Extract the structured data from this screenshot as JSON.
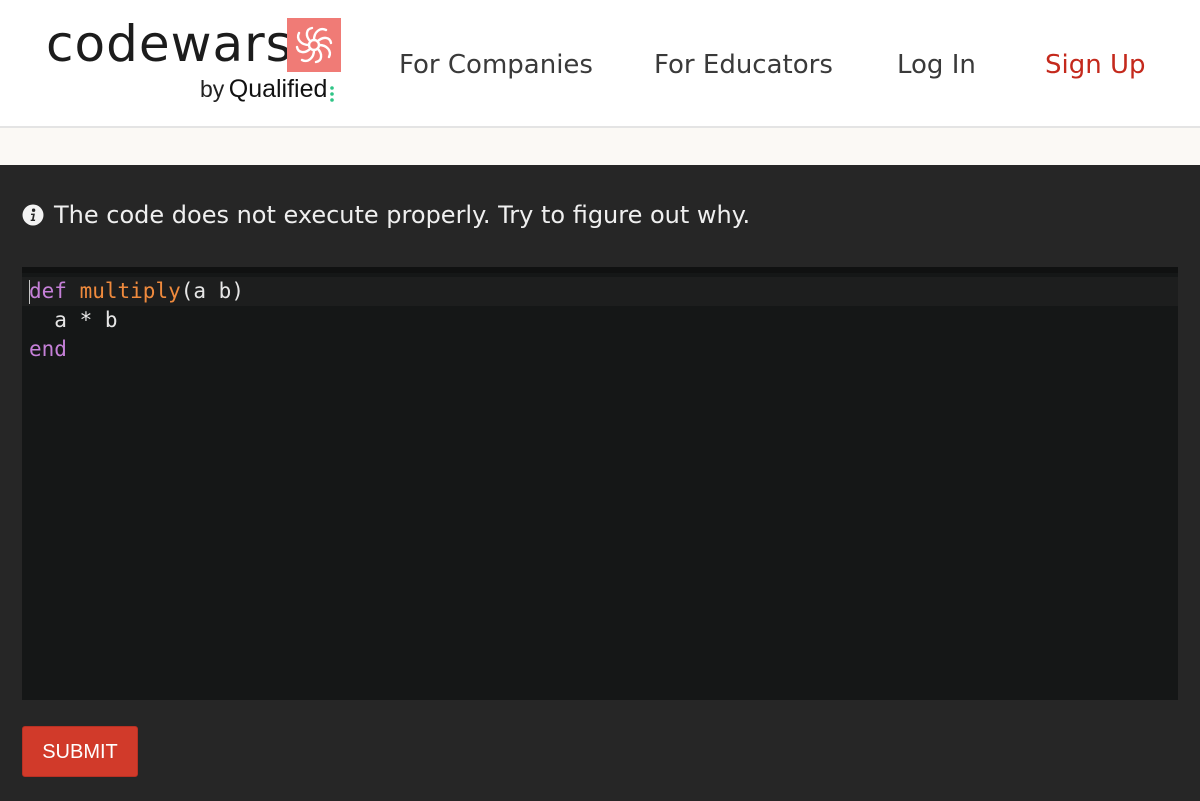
{
  "header": {
    "logo": {
      "wordmark": "codewars",
      "by": "by",
      "brand": "Qualified"
    },
    "nav": [
      {
        "label": "For Companies"
      },
      {
        "label": "For Educators"
      },
      {
        "label": "Log In"
      },
      {
        "label": "Sign Up"
      }
    ]
  },
  "notice": {
    "icon": "info-icon",
    "text": "The code does not execute properly. Try to figure out why."
  },
  "editor": {
    "lines": [
      {
        "tokens": [
          {
            "text": "def",
            "type": "keyword"
          },
          {
            "text": " ",
            "type": "plain"
          },
          {
            "text": "multiply",
            "type": "function"
          },
          {
            "text": "(a b)",
            "type": "plain"
          }
        ]
      },
      {
        "tokens": [
          {
            "text": "  a * b",
            "type": "plain"
          }
        ]
      },
      {
        "tokens": [
          {
            "text": "end",
            "type": "keyword"
          }
        ]
      }
    ]
  },
  "submit": {
    "label": "SUBMIT"
  },
  "colors": {
    "brand_red": "#d13a2a",
    "sign_up": "#c4291c",
    "logo_mark": "#f07b76",
    "qualified_dots": "#2fc486",
    "keyword": "#c580d8",
    "function": "#ef8a3d",
    "editor_bg": "#151717",
    "page_bg": "#262626"
  }
}
